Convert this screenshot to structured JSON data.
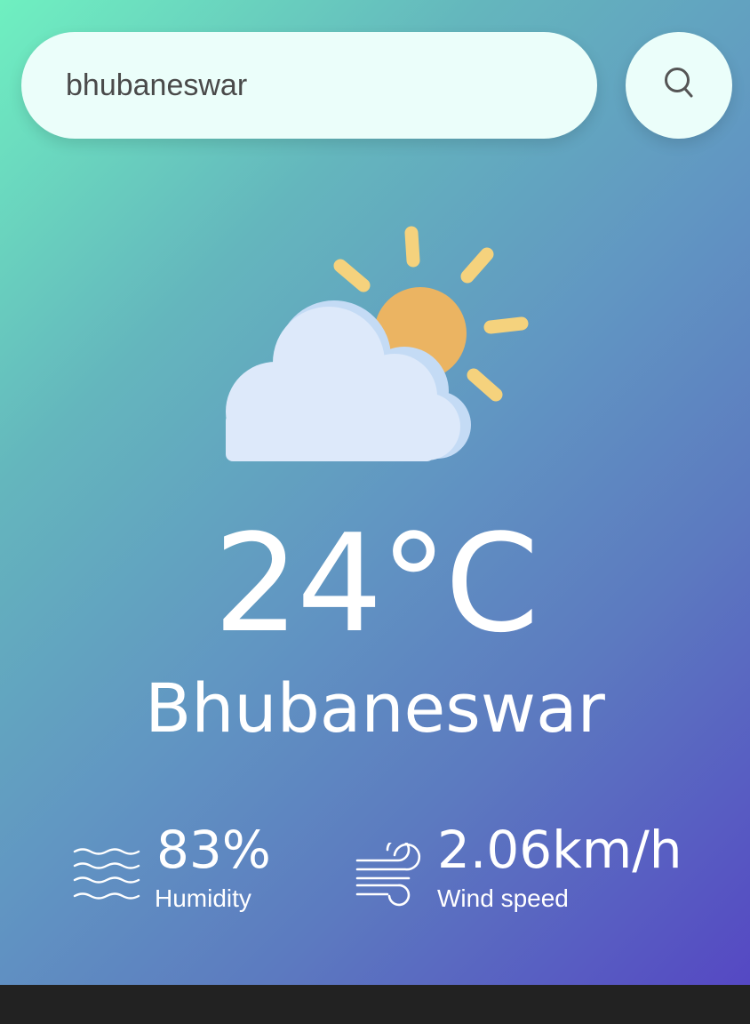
{
  "search": {
    "value": "bhubaneswar",
    "button_icon": "search-icon"
  },
  "weather": {
    "icon": "partly-cloudy-icon",
    "temperature": "24°C",
    "city": "Bhubaneswar"
  },
  "details": {
    "humidity": {
      "icon": "humidity-waves-icon",
      "value": "83%",
      "label": "Humidity"
    },
    "wind": {
      "icon": "wind-icon",
      "value": "2.06km/h",
      "label": "Wind speed"
    }
  },
  "colors": {
    "gradient_start": "#6ff0c0",
    "gradient_end": "#5548c3",
    "input_bg": "#ebfefa",
    "sun": "#ebb462",
    "sun_rays": "#f5d27d",
    "cloud": "#dde9fa",
    "cloud_shade": "#c4dbf5",
    "bottom_bar": "#222222"
  }
}
